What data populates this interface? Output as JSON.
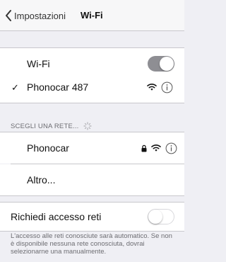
{
  "nav": {
    "back_label": "Impostazioni",
    "title": "Wi-Fi"
  },
  "wifi_toggle": {
    "label": "Wi-Fi",
    "state": "on"
  },
  "connected_network": {
    "name": "Phonocar 487",
    "checkmark": "✓",
    "icons": [
      "wifi-icon",
      "info-icon"
    ]
  },
  "networks_section": {
    "header": "SCEGLI UNA RETE...",
    "spinner_icon": "loading-spinner-icon"
  },
  "networks": [
    {
      "name": "Phonocar",
      "icons": [
        "lock-icon",
        "wifi-icon",
        "info-icon"
      ]
    },
    {
      "name": "Altro..."
    }
  ],
  "ask_to_join": {
    "label": "Richiedi accesso reti",
    "state": "off",
    "footer": "L'accesso alle reti conosciute sarà automatico. Se non è disponibile nessuna rete conosciuta, dovrai selezionarne una manualmente."
  },
  "colors": {
    "background": "#efeff4",
    "separator": "#c8c7cc",
    "toggle_on": "#8e8e93",
    "secondary_text": "#6d6d72"
  }
}
